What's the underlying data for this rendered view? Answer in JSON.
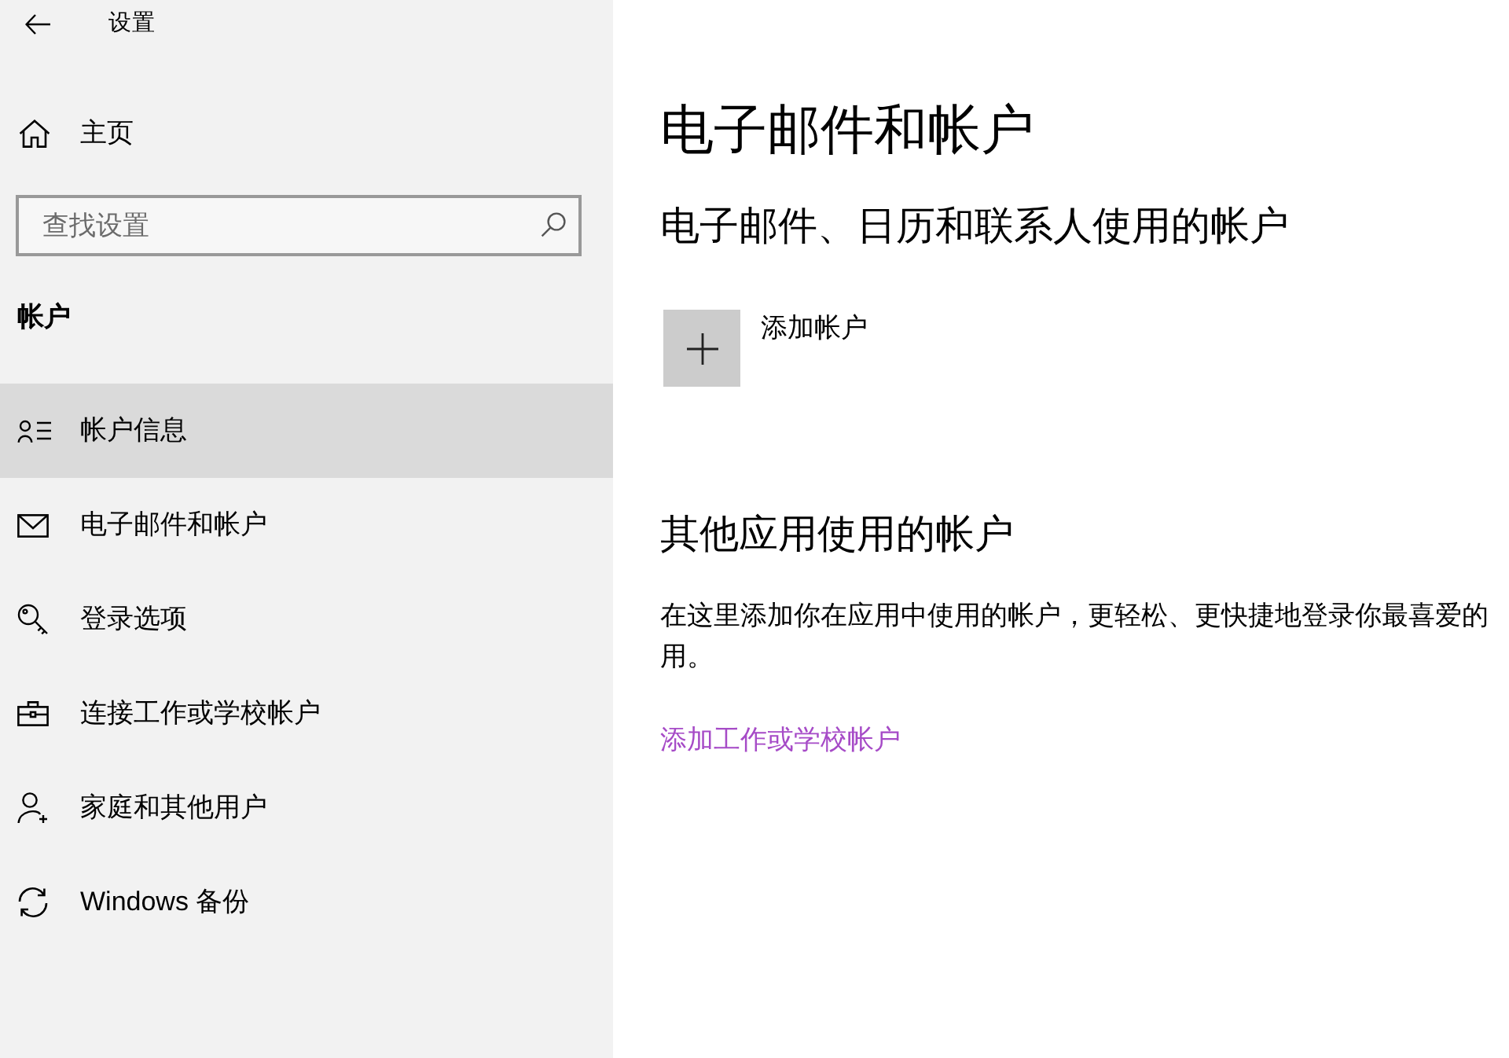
{
  "window": {
    "title": "设置"
  },
  "sidebar": {
    "home": "主页",
    "search": {
      "placeholder": "查找设置"
    },
    "section_title": "帐户",
    "items": [
      {
        "label": "帐户信息",
        "selected": true
      },
      {
        "label": "电子邮件和帐户",
        "selected": false
      },
      {
        "label": "登录选项",
        "selected": false
      },
      {
        "label": "连接工作或学校帐户",
        "selected": false
      },
      {
        "label": "家庭和其他用户",
        "selected": false
      },
      {
        "label": "Windows 备份",
        "selected": false
      }
    ]
  },
  "page": {
    "title": "电子邮件和帐户",
    "email_section": {
      "heading": "电子邮件、日历和联系人使用的帐户",
      "add_account": "添加帐户"
    },
    "other_section": {
      "heading": "其他应用使用的帐户",
      "description_lines": [
        "在这里添加你在应用中使用的帐户，更轻松、更快捷地登录你最喜爱的",
        "用。"
      ],
      "link": "添加工作或学校帐户"
    }
  }
}
